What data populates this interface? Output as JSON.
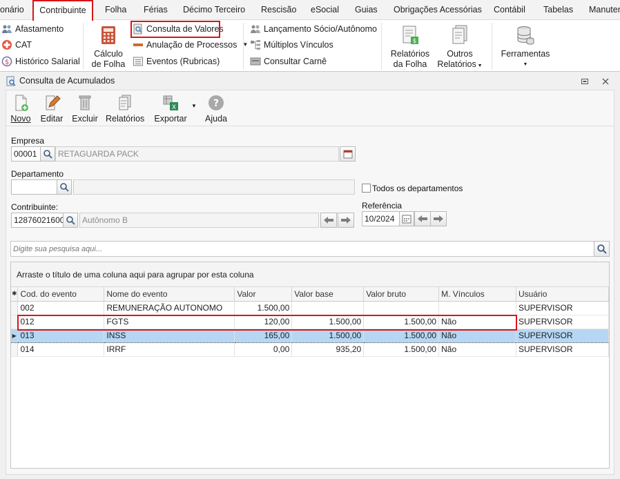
{
  "menu": {
    "items": [
      "onário",
      "Contribuinte",
      "Folha",
      "Férias",
      "Décimo Terceiro",
      "Rescisão",
      "eSocial",
      "Guias",
      "Obrigações Acessórias",
      "Contábil",
      "Tabelas",
      "Manuten"
    ],
    "active": "Contribuinte"
  },
  "ribbon": {
    "afastamento": "Afastamento",
    "cat": "CAT",
    "historico_salarial": "Histórico Salarial",
    "calculo_folha_1": "Cálculo",
    "calculo_folha_2": "de Folha",
    "consulta_valores": "Consulta de Valores",
    "anulacao_processos": "Anulação de Processos",
    "eventos_rubricas": "Eventos (Rubricas)",
    "lancamento_socio": "Lançamento Sócio/Autônomo",
    "multiplos_vinculos": "Múltiplos Vínculos",
    "consultar_carne": "Consultar Carnê",
    "relatorios_folha_1": "Relatórios",
    "relatorios_folha_2": "da Folha",
    "outros_relatorios_1": "Outros",
    "outros_relatorios_2": "Relatórios",
    "ferramentas": "Ferramentas"
  },
  "window": {
    "title": "Consulta de Acumulados"
  },
  "toolbar": {
    "novo": "Novo",
    "editar": "Editar",
    "excluir": "Excluir",
    "relatorios": "Relatórios",
    "exportar": "Exportar",
    "ajuda": "Ajuda"
  },
  "form": {
    "empresa_label": "Empresa",
    "empresa_code": "00001",
    "empresa_name": "RETAGUARDA PACK",
    "departamento_label": "Departamento",
    "departamento_code": "",
    "departamento_name": "",
    "todos_departamentos": "Todos os departamentos",
    "contribuinte_label": "Contribuinte:",
    "contribuinte_code": "12876021600",
    "contribuinte_name": "Autônomo B",
    "referencia_label": "Referência",
    "referencia_value": "10/2024",
    "search_placeholder": "Digite sua pesquisa aqui..."
  },
  "grid": {
    "group_hint": "Arraste o título de uma coluna aqui para agrupar por esta coluna",
    "columns": [
      "Cod. do evento",
      "Nome do evento",
      "Valor",
      "Valor base",
      "Valor bruto",
      "M. Vínculos",
      "Usuário"
    ],
    "rows": [
      {
        "cod": "002",
        "nome": "REMUNERAÇÃO AUTONOMO",
        "valor": "1.500,00",
        "valor_base": "",
        "valor_bruto": "",
        "vinculos": "",
        "usuario": "SUPERVISOR"
      },
      {
        "cod": "012",
        "nome": "FGTS",
        "valor": "120,00",
        "valor_base": "1.500,00",
        "valor_bruto": "1.500,00",
        "vinculos": "Não",
        "usuario": "SUPERVISOR"
      },
      {
        "cod": "013",
        "nome": "INSS",
        "valor": "165,00",
        "valor_base": "1.500,00",
        "valor_bruto": "1.500,00",
        "vinculos": "Não",
        "usuario": "SUPERVISOR"
      },
      {
        "cod": "014",
        "nome": "IRRF",
        "valor": "0,00",
        "valor_base": "935,20",
        "valor_bruto": "1.500,00",
        "vinculos": "Não",
        "usuario": "SUPERVISOR"
      }
    ],
    "selected_row": 2
  },
  "colors": {
    "highlight_red": "#d8141a",
    "selection_blue": "#b5d7f4"
  }
}
